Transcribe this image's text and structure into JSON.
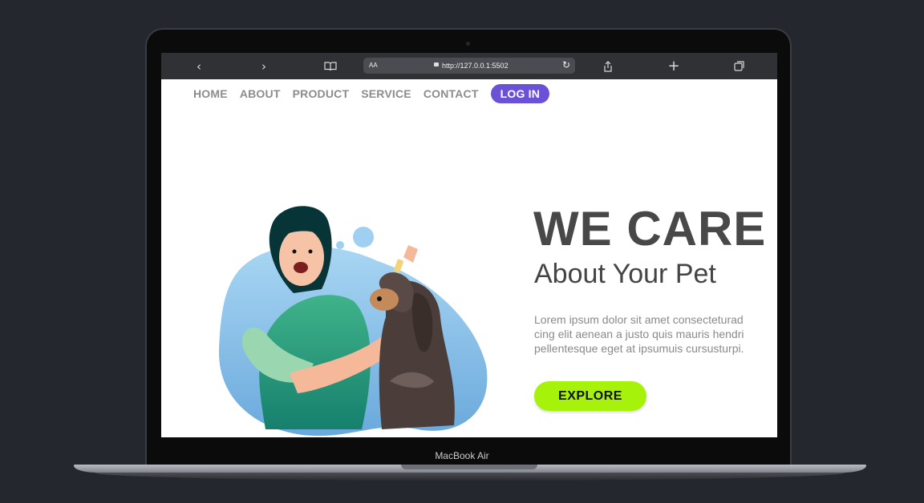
{
  "device": {
    "label": "MacBook Air"
  },
  "browser": {
    "text_size_label": "AA",
    "url": "http://127.0.0.1:5502",
    "icons": [
      "back-icon",
      "forward-icon",
      "book-icon",
      "lock-icon",
      "reload-icon",
      "share-icon",
      "plus-icon",
      "tabs-icon"
    ]
  },
  "nav": {
    "items": [
      "HOME",
      "ABOUT",
      "PRODUCT",
      "SERVICE",
      "CONTACT"
    ],
    "login": "LOG IN"
  },
  "hero": {
    "title": "WE CARE",
    "subtitle": "About Your Pet",
    "body": [
      "Lorem ipsum dolor sit amet consecteturad",
      "cing elit aenean a justo quis mauris hendri",
      "pellentesque eget at ipsumuis cursusturpi."
    ],
    "cta": "EXPLORE"
  },
  "colors": {
    "accent": "#6a51d6",
    "cta": "#a6f20a",
    "text_dark": "#484848",
    "blob_blue": "#8cc6ec"
  }
}
